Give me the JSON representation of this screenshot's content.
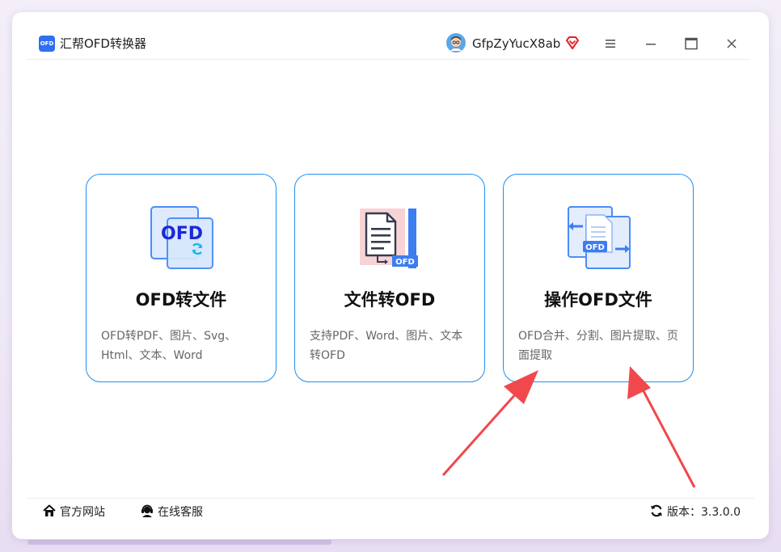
{
  "app": {
    "logo_text": "OFD",
    "title": "汇帮OFD转换器"
  },
  "user": {
    "name": "GfpZyYucX8ab"
  },
  "cards": [
    {
      "icon_label": "OFD",
      "title": "OFD转文件",
      "desc": "OFD转PDF、图片、Svg、Html、文本、Word"
    },
    {
      "icon_label": "OFD",
      "title": "文件转OFD",
      "desc": "支持PDF、Word、图片、文本转OFD"
    },
    {
      "icon_label": "OFD",
      "title": "操作OFD文件",
      "desc": "OFD合并、分割、图片提取、页面提取"
    }
  ],
  "footer": {
    "website": "官方网站",
    "service": "在线客服",
    "version": "版本：3.3.0.0"
  },
  "colors": {
    "accent": "#1e8ff0",
    "arrow": "#f0484d",
    "vip": "#e0222a"
  }
}
